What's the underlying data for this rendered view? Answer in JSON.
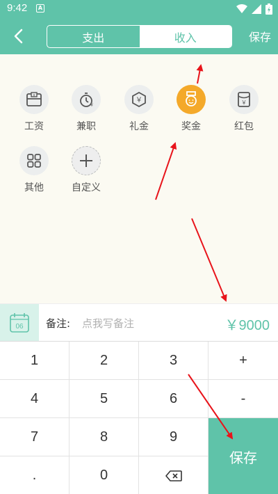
{
  "status_bar": {
    "time": "9:42",
    "notification_icon": "A"
  },
  "header": {
    "tabs": [
      {
        "label": "支出",
        "active": false
      },
      {
        "label": "收入",
        "active": true
      }
    ],
    "save_label": "保存"
  },
  "categories": [
    {
      "label": "工资",
      "icon": "wallet-icon"
    },
    {
      "label": "兼职",
      "icon": "stopwatch-icon"
    },
    {
      "label": "礼金",
      "icon": "yen-gift-icon"
    },
    {
      "label": "奖金",
      "icon": "medal-icon",
      "selected": true
    },
    {
      "label": "红包",
      "icon": "red-envelope-icon"
    },
    {
      "label": "其他",
      "icon": "grid-icon"
    },
    {
      "label": "自定义",
      "icon": "plus-icon"
    }
  ],
  "note": {
    "calendar_day": "06",
    "label": "备注:",
    "placeholder": "点我写备注",
    "amount": "￥9000"
  },
  "keypad": {
    "keys": [
      "1",
      "2",
      "3",
      "+",
      "4",
      "5",
      "6",
      "-",
      "7",
      "8",
      "9",
      ".",
      "0"
    ],
    "save_label": "保存"
  },
  "colors": {
    "primary": "#5fc3a9",
    "accent": "#f4a92a",
    "background": "#fbfaf2",
    "arrow": "#e8141b"
  }
}
